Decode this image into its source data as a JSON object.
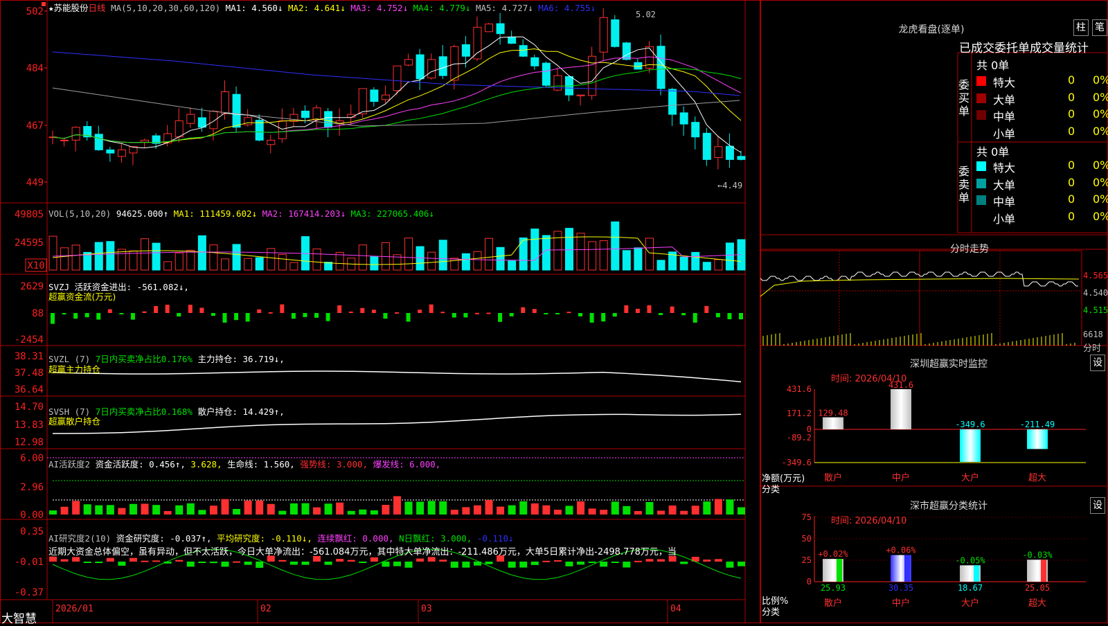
{
  "colors": {
    "up": "#ff3030",
    "down": "#00f0f0",
    "ma1": "#ffffff",
    "ma2": "#ffff00",
    "ma3": "#ff40ff",
    "ma4": "#00e000",
    "ma5": "#a0a0a0",
    "ma6": "#3030ff",
    "grid": "#b00000",
    "axis": "#ff2020"
  },
  "header": {
    "stock_name": "★苏能股份",
    "period": "日线",
    "ma_label": "MA(5,10,20,30,60,120)",
    "ma1": "MA1: 4.560↓",
    "ma2": "MA2: 4.641↓",
    "ma3": "MA3: 4.752↓",
    "ma4": "MA4: 4.779↓",
    "ma5": "MA5: 4.727↓",
    "ma6": "MA6: 4.755↓",
    "high_mark": "5.02",
    "low_mark": "←4.49"
  },
  "price_axis": [
    "502",
    "484",
    "467",
    "449"
  ],
  "vol_header": {
    "label": "VOL(5,10,20)",
    "value": "94625.000↑",
    "ma1": "MA1: 111459.602↓",
    "ma2": "MA2: 167414.203↓",
    "ma3": "MA3: 227065.406↓"
  },
  "vol_axis": [
    "49805",
    "24595",
    "X10"
  ],
  "svzj": {
    "label": "SVZJ  活跃资金进出: -561.082↓,",
    "sub": "超赢资金流(万元)",
    "axis": [
      "2629",
      "88",
      "-2454"
    ]
  },
  "svzl": {
    "label": "SVZL (7)",
    "ratio": "7日内买卖净占比0.176%",
    "hold": "主力持仓: 36.719↓,",
    "sub": "超赢主力持仓",
    "axis": [
      "38.31",
      "37.48",
      "36.64"
    ]
  },
  "svsh": {
    "label": "SVSH (7)",
    "ratio": "7日内买卖净占比0.168%",
    "hold": "散户持仓: 14.429↑,",
    "sub": "超赢散户持仓",
    "axis": [
      "14.70",
      "13.83",
      "12.98"
    ]
  },
  "ai1": {
    "label": "AI活跃度2",
    "p1": "资金活跃度: 0.456↑,",
    "p2": "3.628,",
    "p3": "生命线: 1.560,",
    "p4": "强势线: 3.000,",
    "p5": "爆发线: 6.000,",
    "axis": [
      "6.00",
      "2.96",
      "0.00"
    ]
  },
  "ai2": {
    "label": "AI研究度2(10)",
    "p1": "资金研究度: -0.037↑,",
    "p2": "平均研究度: -0.110↓,",
    "p3": "连续飘红: 0.000,",
    "p4": "N日飘红: 3.000,",
    "p5": "-0.110↓",
    "text": "近期大资金总体偏空，虽有异动，但不太活跃，今日大单净流出：-561.084万元，其中特大单净流出：-211.486万元，大单5日累计净出-2498.778万元，当",
    "axis": [
      "0.35",
      "-0.01",
      "-0.37"
    ]
  },
  "date_axis": [
    "2026/01",
    "02",
    "03",
    "04"
  ],
  "logo": "大智慧",
  "right": {
    "lhb_title": "龙虎看盘(逐单)",
    "btn1": "柱",
    "btn2": "笔",
    "stat_title": "已成交委托单成交量统计",
    "buy_label": "委买单",
    "sell_label": "委卖单",
    "buy_total": "共 0单",
    "sell_total": "共 0单",
    "buy_rows": [
      {
        "name": "特大",
        "n": "0",
        "p": "0%",
        "c": "#ff0000"
      },
      {
        "name": "大单",
        "n": "0",
        "p": "0%",
        "c": "#a00000"
      },
      {
        "name": "中单",
        "n": "0",
        "p": "0%",
        "c": "#700000"
      },
      {
        "name": "小单",
        "n": "0",
        "p": "0%",
        "c": "#000000"
      }
    ],
    "sell_rows": [
      {
        "name": "特大",
        "n": "0",
        "p": "0%",
        "c": "#00ffff"
      },
      {
        "name": "大单",
        "n": "0",
        "p": "0%",
        "c": "#00a0a0"
      },
      {
        "name": "中单",
        "n": "0",
        "p": "0%",
        "c": "#008080"
      },
      {
        "name": "小单",
        "n": "0",
        "p": "0%",
        "c": "#000000"
      }
    ],
    "intraday_title": "分时走势",
    "intraday_axis": [
      "4.565",
      "4.540",
      "4.515"
    ],
    "intraday_vol": "6618",
    "intraday_unit": "分时",
    "monitor_title": "深圳超赢实时监控",
    "monitor_btn": "设",
    "monitor_time": "时间: 2026/04/10",
    "monitor_axis": [
      "431.6",
      "171.2",
      "0",
      "-89.2",
      "-349.6"
    ],
    "monitor_ylabel": "净额(万元)",
    "monitor_xlabel": "分类",
    "classify_title": "深市超赢分类统计",
    "classify_btn": "设",
    "classify_time": "时间: 2026/04/10",
    "classify_axis": [
      "75",
      "50",
      "25",
      "0"
    ],
    "classify_ylabel": "比例%",
    "classify_xlabel": "分类"
  },
  "chart_data": [
    {
      "type": "bar",
      "title": "深圳超赢实时监控",
      "categories": [
        "散户",
        "中户",
        "大户",
        "超大"
      ],
      "values": [
        129.48,
        431.6,
        -349.6,
        -211.49
      ],
      "labels": [
        "129.48",
        "431.6",
        "-349.6",
        "-211.49"
      ],
      "ylim": [
        -349.6,
        431.6
      ]
    },
    {
      "type": "bar",
      "title": "深市超赢分类统计",
      "categories": [
        "散户",
        "中户",
        "大户",
        "超大"
      ],
      "values": [
        25.93,
        30.35,
        18.67,
        25.05
      ],
      "changes": [
        "+0.02%",
        "+0.06%",
        "-0.05%",
        "-0.03%"
      ],
      "ylim": [
        0,
        75
      ]
    }
  ]
}
